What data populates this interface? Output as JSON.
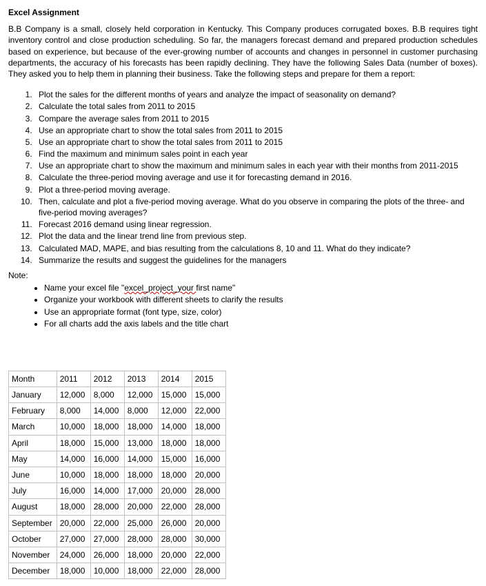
{
  "title": "Excel Assignment",
  "intro": "B.B Company is a small, closely held corporation in Kentucky. This Company produces corrugated boxes. B.B requires tight inventory control and close production scheduling. So far, the managers forecast demand and prepared production schedules based on experience, but because of the ever-growing number of accounts and changes in personnel in customer purchasing departments, the accuracy of his forecasts has been rapidly declining. They have the following Sales Data (number of boxes). They asked you to help them in planning their business. Take the following steps and prepare for them a report:",
  "steps": [
    "Plot the sales for the different months of years and analyze the impact of seasonality on demand?",
    "Calculate the total sales from 2011 to 2015",
    "Compare the average sales from 2011 to 2015",
    "Use an appropriate chart to show the total sales from 2011 to 2015",
    "Use an appropriate chart to show the total sales from 2011 to 2015",
    "Find the maximum and minimum sales point in each year",
    "Use an appropriate chart to show the maximum and minimum sales in each year with their months from 2011-2015",
    "Calculate the three-period moving average and use it for forecasting demand in 2016.",
    "Plot a three-period moving average.",
    "Then, calculate and plot a five-period moving average. What do you observe in comparing the plots of the three- and five-period moving averages?",
    "Forecast 2016 demand using linear regression.",
    "Plot the data and the linear trend line from previous step.",
    "Calculated MAD, MAPE, and bias resulting from the calculations 8, 10 and 11. What do they indicate?",
    "Summarize the results and suggest the guidelines for the managers"
  ],
  "note_label": "Note:",
  "notes_pre": "Name your excel file \"",
  "notes_wavy": "excel_project_your ",
  "notes_post": "first name\"",
  "notes_rest": [
    "Organize your workbook with different sheets to clarify the results",
    "Use an appropriate format (font type, size, color)",
    "For all charts add the axis labels and the title chart"
  ],
  "table": {
    "header_month": "Month",
    "years": [
      "2011",
      "2012",
      "2013",
      "2014",
      "2015"
    ],
    "rows": [
      {
        "month": "January",
        "vals": [
          "12,000",
          "8,000",
          "12,000",
          "15,000",
          "15,000"
        ]
      },
      {
        "month": "February",
        "vals": [
          "8,000",
          "14,000",
          "8,000",
          "12,000",
          "22,000"
        ]
      },
      {
        "month": "March",
        "vals": [
          "10,000",
          "18,000",
          "18,000",
          "14,000",
          "18,000"
        ]
      },
      {
        "month": "April",
        "vals": [
          "18,000",
          "15,000",
          "13,000",
          "18,000",
          "18,000"
        ]
      },
      {
        "month": "May",
        "vals": [
          "14,000",
          "16,000",
          "14,000",
          "15,000",
          "16,000"
        ]
      },
      {
        "month": "June",
        "vals": [
          "10,000",
          "18,000",
          "18,000",
          "18,000",
          "20,000"
        ]
      },
      {
        "month": "July",
        "vals": [
          "16,000",
          "14,000",
          "17,000",
          "20,000",
          "28,000"
        ]
      },
      {
        "month": "August",
        "vals": [
          "18,000",
          "28,000",
          "20,000",
          "22,000",
          "28,000"
        ]
      },
      {
        "month": "September",
        "vals": [
          "20,000",
          "22,000",
          "25,000",
          "26,000",
          "20,000"
        ]
      },
      {
        "month": "October",
        "vals": [
          "27,000",
          "27,000",
          "28,000",
          "28,000",
          "30,000"
        ]
      },
      {
        "month": "November",
        "vals": [
          "24,000",
          "26,000",
          "18,000",
          "20,000",
          "22,000"
        ]
      },
      {
        "month": "December",
        "vals": [
          "18,000",
          "10,000",
          "18,000",
          "22,000",
          "28,000"
        ]
      }
    ]
  }
}
